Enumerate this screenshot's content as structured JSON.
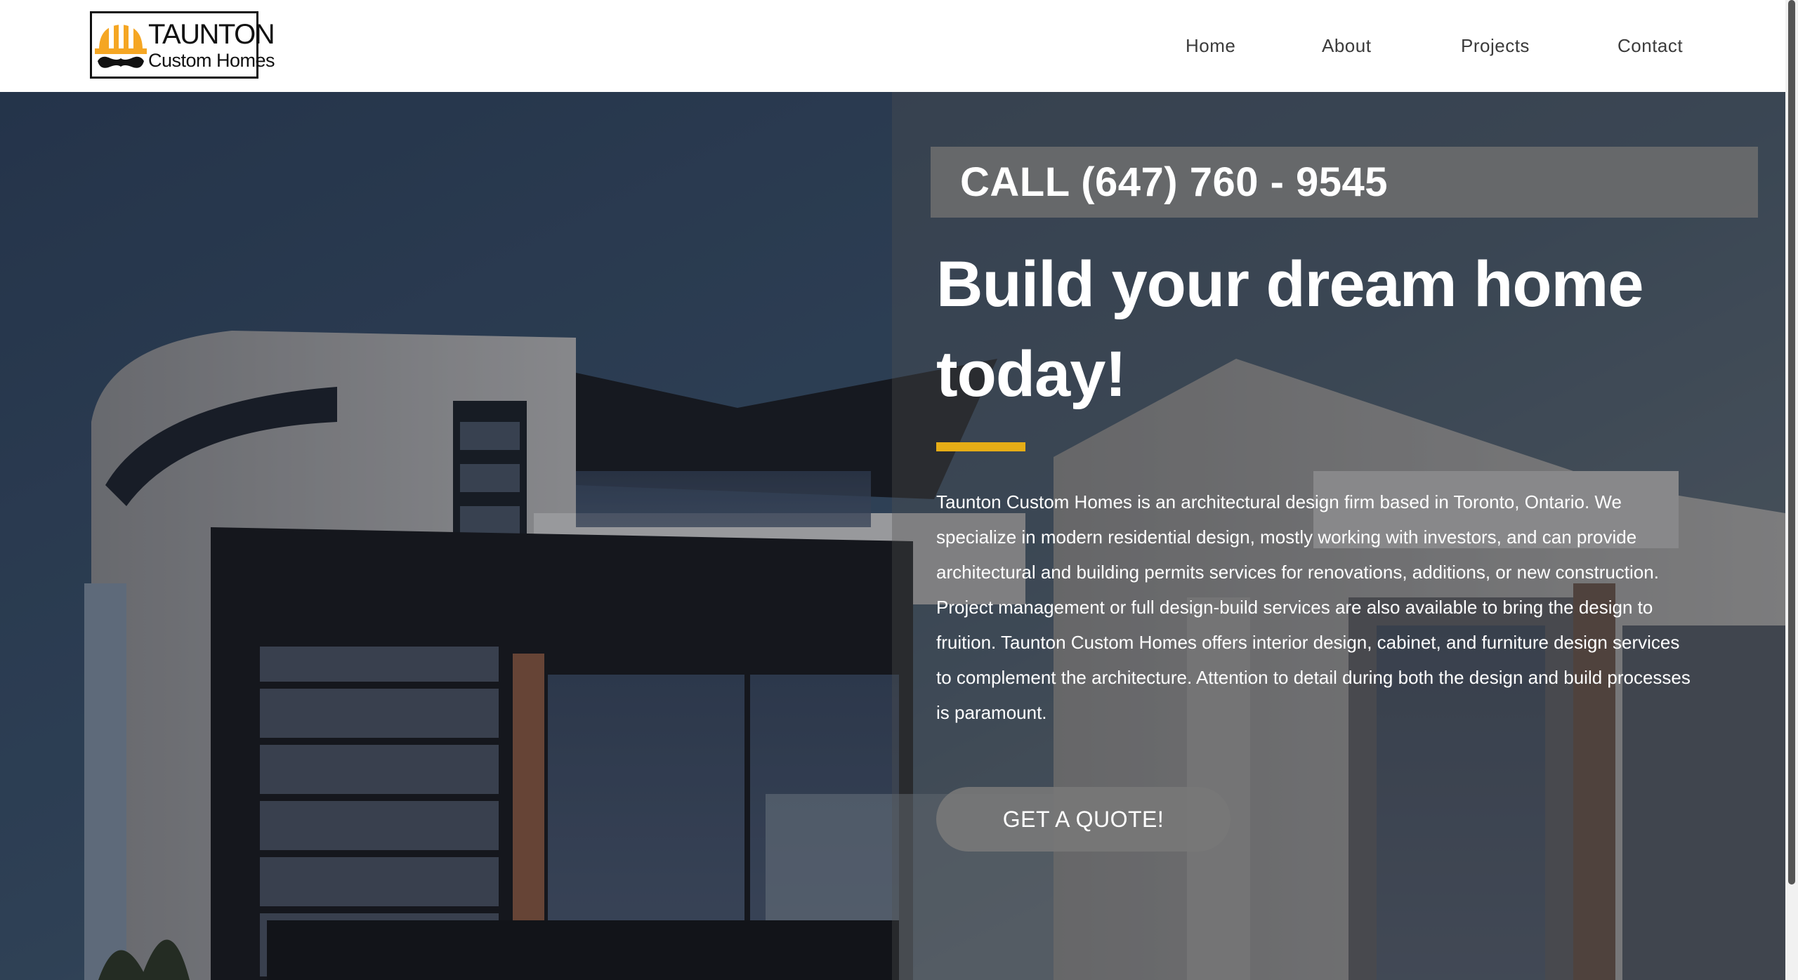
{
  "brand": {
    "name_top": "TAUNTON",
    "name_bottom": "Custom Homes",
    "logo_icon": "hardhat-mustache-icon",
    "accent_color": "#f5a623"
  },
  "nav": {
    "items": [
      {
        "label": "Home"
      },
      {
        "label": "About"
      },
      {
        "label": "Projects"
      },
      {
        "label": "Contact"
      }
    ]
  },
  "hero": {
    "call_text": "CALL (647) 760 - 9545",
    "headline_line1": "Build your dream home",
    "headline_line2": "today!",
    "accent_color": "#e6ad16",
    "description": "Taunton Custom Homes is an architectural design firm based in Toronto, Ontario. We specialize in modern residential design, mostly working with investors, and can provide architectural and building permits services for renovations, additions, or new construction. Project management or full design-build services are also available to bring the design to fruition. Taunton Custom Homes offers interior design, cabinet, and furniture design services to complement the architecture. Attention to detail during both the design and build processes is paramount.",
    "cta_label": "GET A QUOTE!",
    "background_image": "modern-house-photo"
  }
}
